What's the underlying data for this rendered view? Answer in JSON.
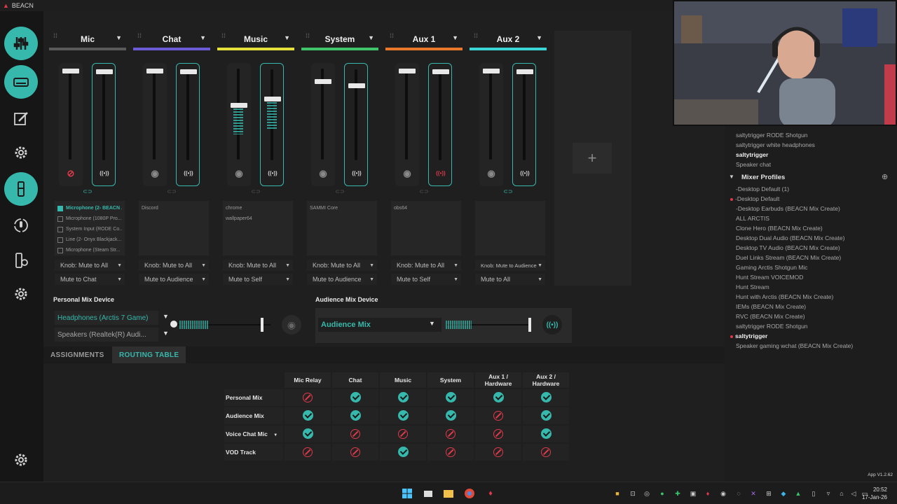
{
  "app": {
    "title": "BEACN",
    "version": "App V1.2.62"
  },
  "strips": [
    {
      "name": "Mic",
      "color": "#5a5a5a",
      "left_level": 1.0,
      "right_level": 1.0,
      "left_fill": 0,
      "right_fill": 0,
      "left_icon": "mic-muted-icon",
      "right_icon": "broadcast-icon",
      "sources": [
        {
          "label": "Microphone (2- BEACN ...",
          "checked": true
        },
        {
          "label": "Microphone (1080P Pro...",
          "checked": false
        },
        {
          "label": "System Input (RODE Co...",
          "checked": false
        },
        {
          "label": "Line (2- Onyx Blackjack...",
          "checked": false
        },
        {
          "label": "Microphone (Steam Str...",
          "checked": false
        }
      ],
      "knob": "Knob: Mute to All",
      "mute": "Mute to Chat"
    },
    {
      "name": "Chat",
      "color": "#6b5bd6",
      "left_level": 1.0,
      "right_level": 1.0,
      "left_fill": 0,
      "right_fill": 0,
      "left_icon": "headphones-icon",
      "right_icon": "broadcast-icon",
      "sources": [
        {
          "label": "Discord",
          "checked": null
        }
      ],
      "knob": "Knob: Mute to All",
      "mute": "Mute to Audience"
    },
    {
      "name": "Music",
      "color": "#e5e03a",
      "left_level": 0.6,
      "right_level": 0.68,
      "left_fill": 0.3,
      "right_fill": 0.33,
      "left_icon": "headphones-icon",
      "right_icon": "broadcast-icon",
      "sources": [
        {
          "label": "chrome",
          "checked": null
        },
        {
          "label": "wallpaper64",
          "checked": null
        }
      ],
      "knob": "Knob: Mute to All",
      "mute": "Mute to Self"
    },
    {
      "name": "System",
      "color": "#3fc46b",
      "left_level": 0.88,
      "right_level": 0.84,
      "left_fill": 0,
      "right_fill": 0,
      "left_icon": "headphones-icon",
      "right_icon": "broadcast-icon",
      "sources": [
        {
          "label": "SAMMI Core",
          "checked": null
        }
      ],
      "knob": "Knob: Mute to All",
      "mute": "Mute to Audience"
    },
    {
      "name": "Aux 1",
      "color": "#e8782a",
      "left_level": 1.0,
      "right_level": 1.0,
      "left_fill": 0,
      "right_fill": 0,
      "left_icon": "headphones-icon",
      "right_icon": "broadcast-muted-icon",
      "sources": [
        {
          "label": "obs64",
          "checked": null
        }
      ],
      "knob": "Knob: Mute to All",
      "mute": "Mute to Self"
    },
    {
      "name": "Aux 2",
      "color": "#3ad6d6",
      "left_level": 1.0,
      "right_level": 1.0,
      "left_fill": 0,
      "right_fill": 0,
      "left_icon": "headphones-icon",
      "right_icon": "broadcast-icon",
      "sources": [],
      "knob": "Knob: Mute to Audience",
      "mute": "Mute to All"
    }
  ],
  "add_strip": "+",
  "personal_mix": {
    "label": "Personal Mix Device",
    "primary": "Headphones (Arctis 7 Game)",
    "secondary": "Speakers (Realtek(R) Audi...",
    "level": 0.9
  },
  "audience_mix": {
    "label": "Audience Mix Device",
    "device": "Audience Mix",
    "level": 0.78
  },
  "tabs": [
    {
      "label": "ASSIGNMENTS",
      "active": false
    },
    {
      "label": "ROUTING TABLE",
      "active": true
    }
  ],
  "routing": {
    "columns": [
      "Mic Relay",
      "Chat",
      "Music",
      "System",
      "Aux 1 / Hardware",
      "Aux 2 / Hardware"
    ],
    "rows": [
      {
        "label": "Personal Mix",
        "values": [
          false,
          true,
          true,
          true,
          true,
          true
        ]
      },
      {
        "label": "Audience Mix",
        "values": [
          true,
          true,
          true,
          true,
          false,
          true
        ]
      },
      {
        "label": "Voice Chat Mic",
        "values": [
          true,
          false,
          false,
          false,
          false,
          true
        ]
      },
      {
        "label": "VOD Track",
        "values": [
          false,
          false,
          true,
          false,
          false,
          false
        ]
      }
    ]
  },
  "right_panel": {
    "devices": [
      "saltytrigger RODE Shotgun",
      "saltytrigger white headphones",
      "saltytrigger",
      "Speaker chat"
    ],
    "selected_device": "saltytrigger",
    "profiles_title": "Mixer Profiles",
    "profiles": [
      "-Desktop Default (1)",
      "-Desktop Default",
      "-Desktop Earbuds (BEACN Mix Create)",
      "ALL ARCTIS",
      "Clone Hero (BEACN Mix Create)",
      "Desktop Dual Audio (BEACN Mix Create)",
      "Desktop TV Audio (BEACN Mix Create)",
      "Duel Links Stream (BEACN Mix Create)",
      "Gaming Arctis Shotgun Mic",
      "Hunt Stream VOICEMOD",
      "Hunt Stream",
      "Hunt with Arctis (BEACN Mix Create)",
      "IEMs (BEACN Mix Create)",
      "RVC (BEACN Mix Create)",
      "saltytrigger RODE Shotgun",
      "saltytrigger",
      "Speaker gaming wchat (BEACN Mix Create)"
    ],
    "marked_profiles": [
      "-Desktop Default",
      "saltytrigger"
    ],
    "selected_profile": "saltytrigger"
  },
  "taskbar": {
    "time": "20:52",
    "date": "17-Jan-26"
  },
  "colors": {
    "accent": "#36b9ac",
    "danger": "#e0394a"
  }
}
